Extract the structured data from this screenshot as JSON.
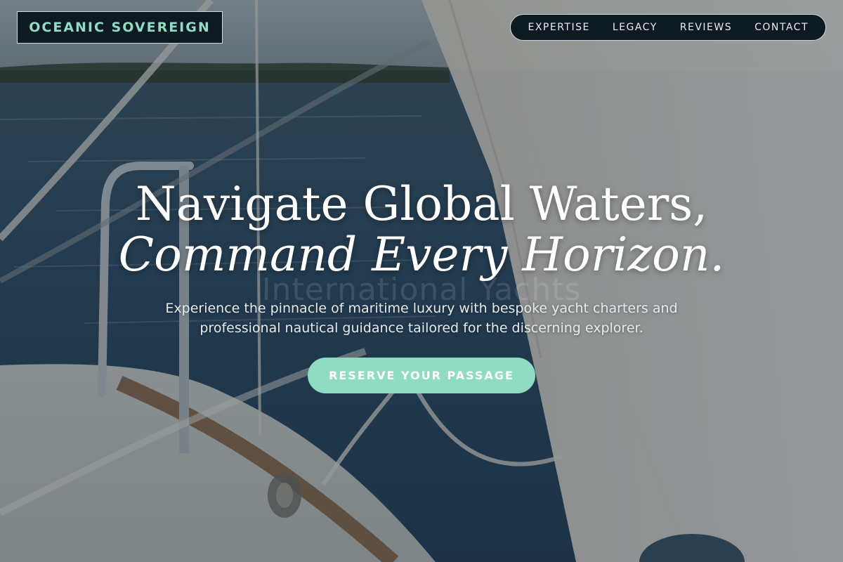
{
  "header": {
    "brand": "OCEANIC SOVEREIGN",
    "nav": [
      "EXPERTISE",
      "LEGACY",
      "REVIEWS",
      "CONTACT"
    ]
  },
  "hero": {
    "title_line1": "Navigate Global Waters,",
    "title_line2": "Command Every Horizon.",
    "watermark": "International Yachts",
    "subtitle": "Experience the pinnacle of maritime luxury with bespoke yacht charters and professional nautical guidance tailored for the discerning explorer.",
    "cta": "RESERVE YOUR PASSAGE"
  },
  "colors": {
    "accent": "#8fdcc3",
    "nav_bg": "#0e1a22"
  }
}
